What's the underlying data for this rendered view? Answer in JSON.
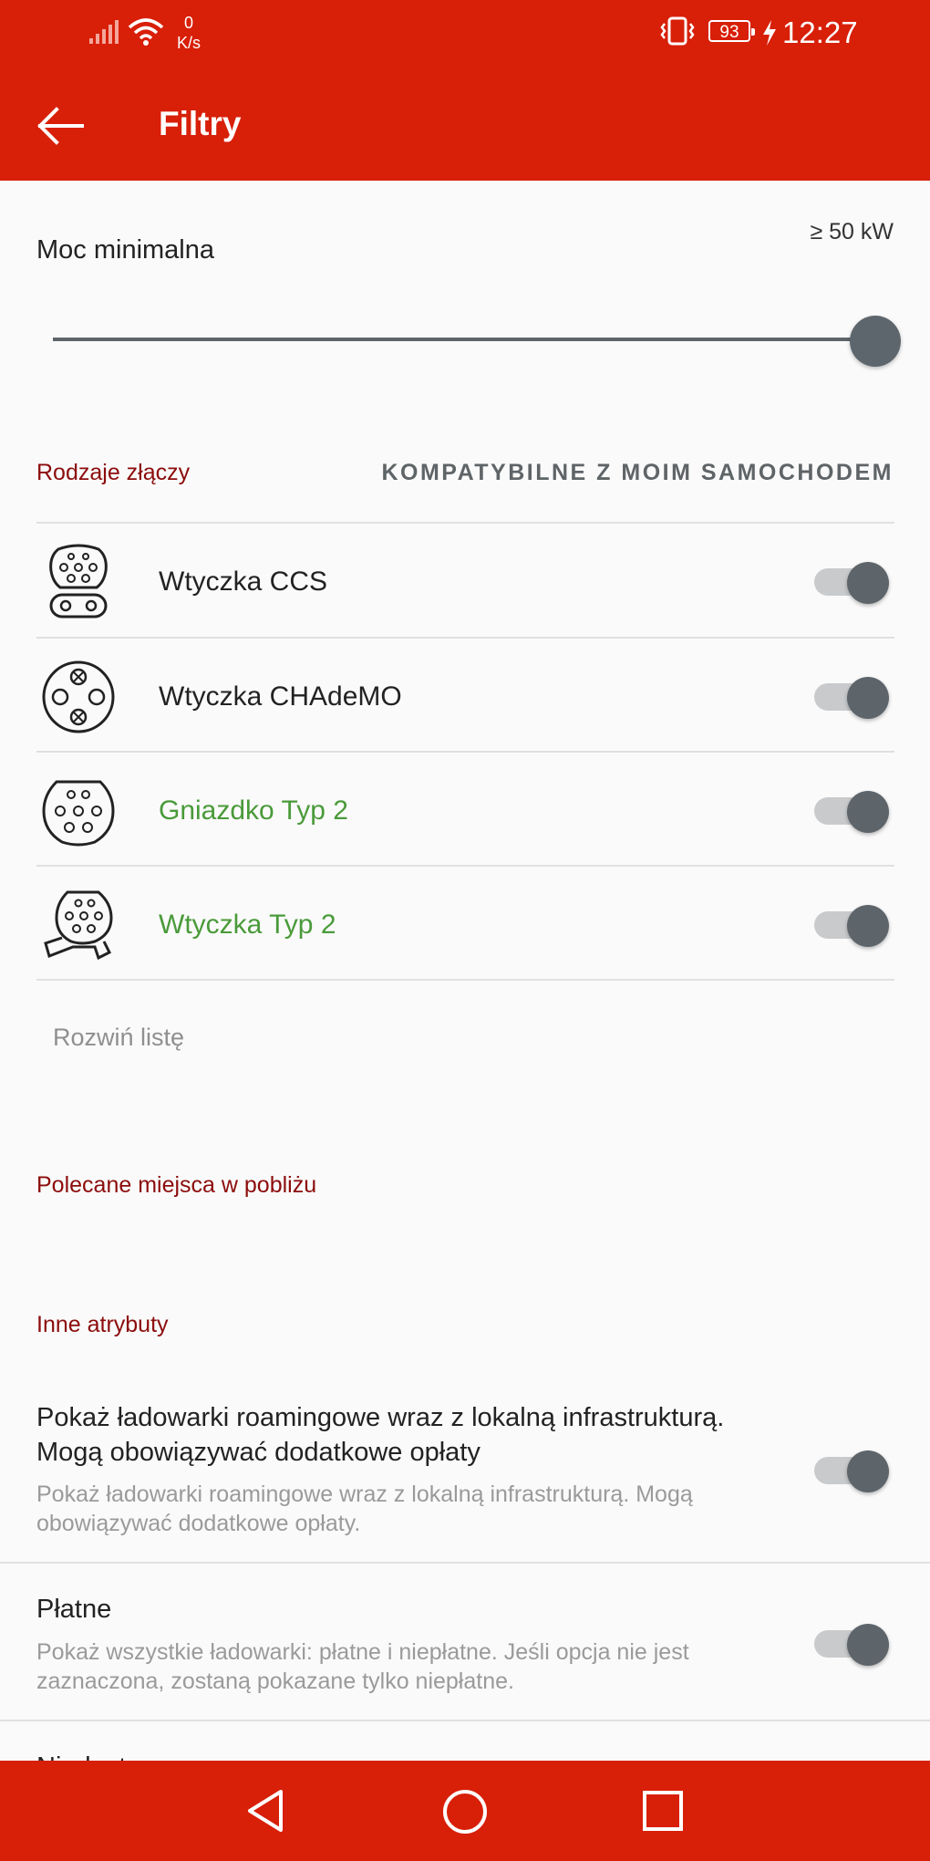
{
  "status_bar": {
    "net_speed_value": "0",
    "net_speed_unit": "K/s",
    "battery": "93",
    "time": "12:27",
    "icons": [
      "signal-icon",
      "wifi-icon",
      "vibrate-icon",
      "battery-icon",
      "charging-icon"
    ]
  },
  "app_bar": {
    "back_icon": "arrow-left-icon",
    "title": "Filtry"
  },
  "power": {
    "label": "Moc minimalna",
    "value_text": "≥ 50 kW",
    "slider_fraction": 1.0
  },
  "connectors": {
    "section_title": "Rodzaje złączy",
    "compatible_button": "KOMPATYBILNE Z MOIM SAMOCHODEM",
    "items": [
      {
        "label": "Wtyczka CCS",
        "icon": "ccs-plug-icon",
        "enabled": true,
        "color": "#222222"
      },
      {
        "label": "Wtyczka CHAdeMO",
        "icon": "chademo-plug-icon",
        "enabled": true,
        "color": "#222222"
      },
      {
        "label": "Gniazdko Typ 2",
        "icon": "type2-socket-icon",
        "enabled": true,
        "color": "#4a9a3a"
      },
      {
        "label": "Wtyczka Typ 2",
        "icon": "type2-plug-icon",
        "enabled": true,
        "color": "#4a9a3a"
      }
    ],
    "expand_label": "Rozwiń listę"
  },
  "recommended": {
    "section_title": "Polecane miejsca w pobliżu"
  },
  "attributes": {
    "section_title": "Inne atrybuty",
    "items": [
      {
        "title": "Pokaż ładowarki roamingowe wraz z lokalną infrastrukturą. Mogą obowiązywać dodatkowe opłaty",
        "description": "Pokaż ładowarki roamingowe wraz z lokalną infrastrukturą. Mogą obowiązywać dodatkowe opłaty.",
        "enabled": true
      },
      {
        "title": "Płatne",
        "description": "Pokaż wszystkie ładowarki: płatne i niepłatne. Jeśli opcja nie jest zaznaczona, zostaną pokazane tylko niepłatne.",
        "enabled": true
      }
    ],
    "partial_next_title": "Niedostępne"
  },
  "nav_bar": {
    "icons": [
      "back-triangle-icon",
      "home-circle-icon",
      "recents-square-icon"
    ]
  },
  "colors": {
    "brand_red": "#d81f08",
    "section_title": "#8c0c0c",
    "compatible_green": "#4a9a3a",
    "toggle_thumb": "#5d656b"
  }
}
